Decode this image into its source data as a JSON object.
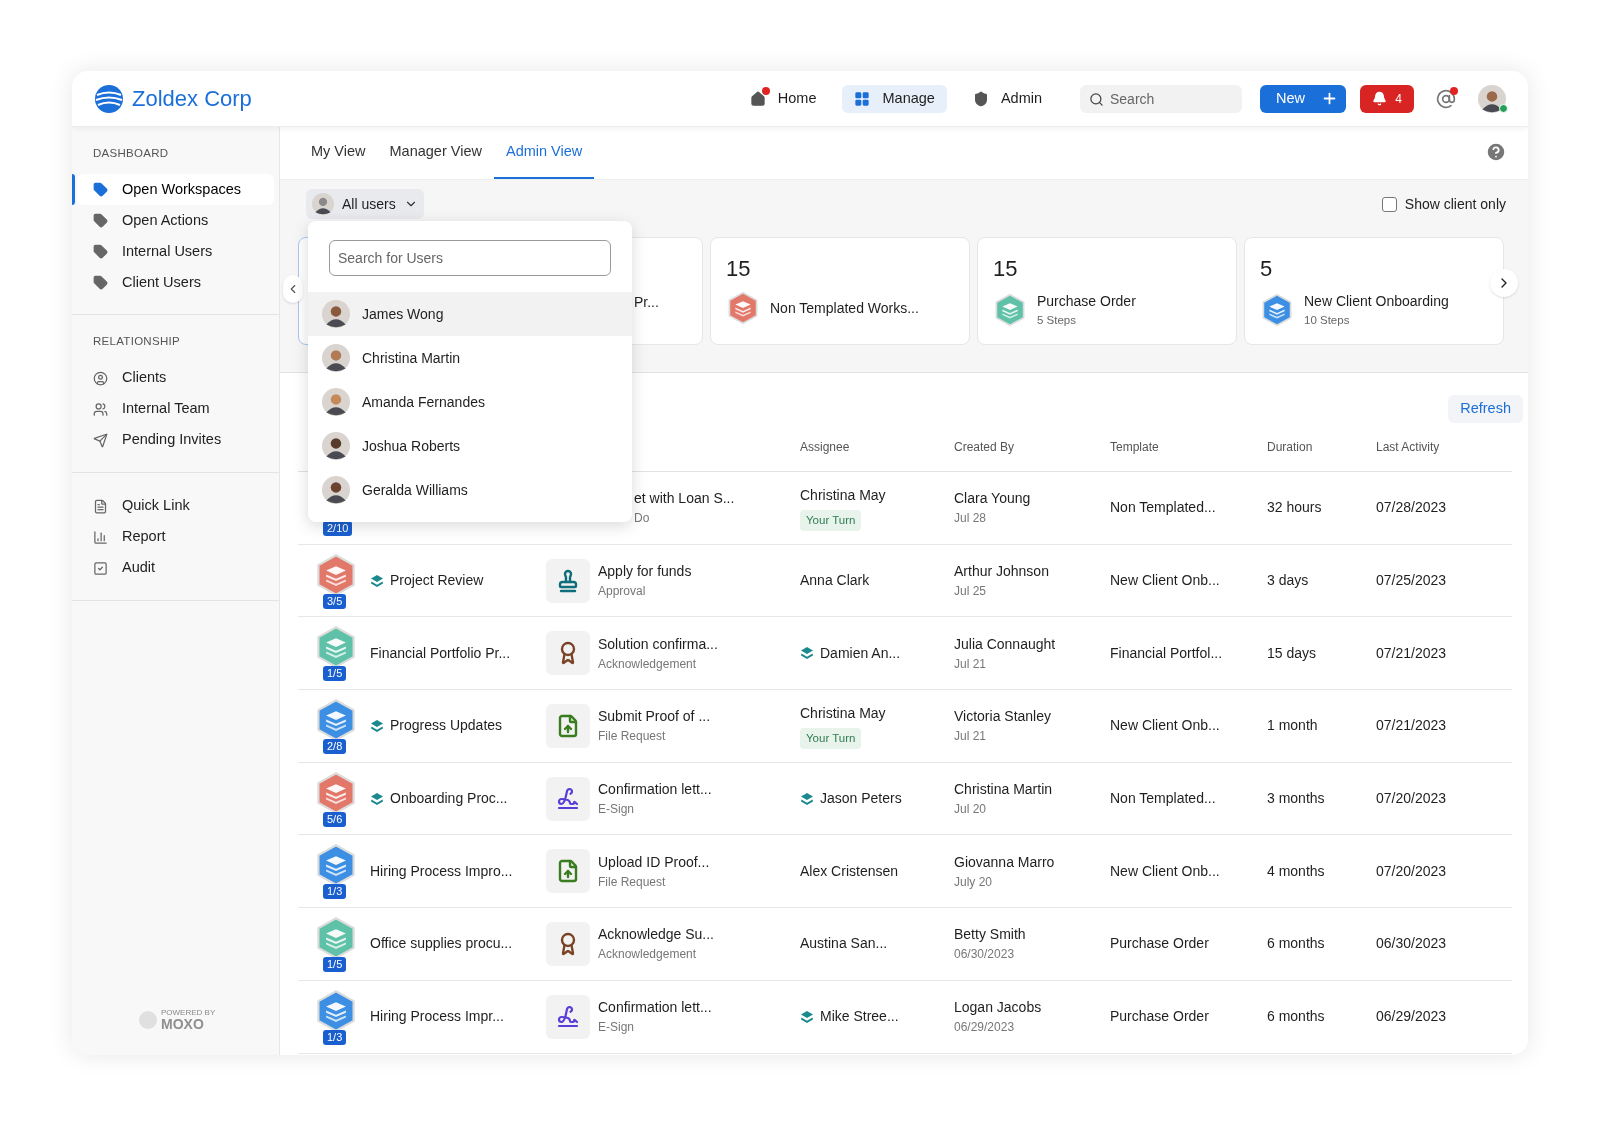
{
  "brand": {
    "name": "Zoldex Corp"
  },
  "nav": [
    {
      "label": "Home",
      "selected": false,
      "dot": true
    },
    {
      "label": "Manage",
      "selected": true,
      "dot": false
    },
    {
      "label": "Admin",
      "selected": false,
      "dot": false
    }
  ],
  "search": {
    "placeholder": "Search"
  },
  "new_button": {
    "label": "New"
  },
  "notifications": {
    "count": "4"
  },
  "mentions": {
    "dot": true
  },
  "profile": {
    "online": true
  },
  "sidebar": {
    "sections": [
      {
        "title": "DASHBOARD",
        "items": [
          {
            "label": "Open Workspaces",
            "selected": true
          },
          {
            "label": "Open Actions",
            "selected": false
          },
          {
            "label": "Internal Users",
            "selected": false
          },
          {
            "label": "Client Users",
            "selected": false
          }
        ]
      },
      {
        "title": "RELATIONSHIP",
        "items": [
          {
            "label": "Clients",
            "selected": false
          },
          {
            "label": "Internal Team",
            "selected": false
          },
          {
            "label": "Pending Invites",
            "selected": false
          }
        ]
      },
      {
        "items": [
          {
            "label": "Quick Link",
            "selected": false
          },
          {
            "label": "Report",
            "selected": false
          },
          {
            "label": "Audit",
            "selected": false
          }
        ]
      }
    ],
    "footer": {
      "caption": "POWERED BY",
      "brand": "MOXO"
    }
  },
  "tabs": [
    {
      "label": "My View",
      "selected": false
    },
    {
      "label": "Manager View",
      "selected": false
    },
    {
      "label": "Admin View",
      "selected": true
    }
  ],
  "user_filter": {
    "label": "All users"
  },
  "show_client_only": {
    "label": "Show client only",
    "checked": false
  },
  "cards": [
    {
      "kind": "partial",
      "selected": true
    },
    {
      "kind": "partial",
      "selected": false,
      "name": "Pr..."
    },
    {
      "kind": "full",
      "selected": false,
      "count": "15",
      "name": "Non Templated Works...",
      "color": "#e2786a"
    },
    {
      "kind": "full",
      "selected": false,
      "count": "15",
      "name": "Purchase Order",
      "steps": "5 Steps",
      "color": "#5fc1a8"
    },
    {
      "kind": "full",
      "selected": false,
      "count": "5",
      "name": "New Client Onboarding",
      "steps": "10 Steps",
      "color": "#3d8fe3"
    }
  ],
  "dropdown": {
    "search": {
      "placeholder": "Search for Users"
    },
    "users": [
      {
        "name": "James Wong",
        "selected": true
      },
      {
        "name": "Christina Martin",
        "selected": false
      },
      {
        "name": "Amanda Fernandes",
        "selected": false
      },
      {
        "name": "Joshua Roberts",
        "selected": false
      },
      {
        "name": "Geralda Williams",
        "selected": false
      }
    ]
  },
  "refresh": {
    "label": "Refresh"
  },
  "table": {
    "columns": [
      {
        "label": "Assignee"
      },
      {
        "label": "Created By"
      },
      {
        "label": "Template"
      },
      {
        "label": "Duration"
      },
      {
        "label": "Last Activity"
      }
    ],
    "rows": [
      {
        "workspace": {
          "badge": "2/10"
        },
        "action": {
          "title": "et with Loan S...",
          "subtitle": "Do"
        },
        "assignee": {
          "name": "Christina May",
          "group": false,
          "your_turn": "Your Turn"
        },
        "created_by": {
          "name": "Clara Young",
          "date": "Jul 28"
        },
        "template": "Non Templated...",
        "duration": "32 hours",
        "last_activity": "07/28/2023"
      },
      {
        "workspace": {
          "badge": "3/5",
          "color": "#e2786a",
          "name": "Project Review",
          "flow": true
        },
        "action": {
          "kind": "approval",
          "title": "Apply for funds",
          "subtitle": "Approval"
        },
        "assignee": {
          "name": "Anna Clark",
          "group": false
        },
        "created_by": {
          "name": "Arthur Johnson",
          "date": "Jul 25"
        },
        "template": "New Client Onb...",
        "duration": "3 days",
        "last_activity": "07/25/2023"
      },
      {
        "workspace": {
          "badge": "1/5",
          "color": "#5fc1a8",
          "name": "Financial Portfolio Pr...",
          "flow": false
        },
        "action": {
          "kind": "acknowledgement",
          "title": "Solution confirma...",
          "subtitle": "Acknowledgement"
        },
        "assignee": {
          "name": "Damien An...",
          "group": true
        },
        "created_by": {
          "name": "Julia Connaught",
          "date": "Jul 21"
        },
        "template": "Financial Portfol...",
        "duration": "15 days",
        "last_activity": "07/21/2023"
      },
      {
        "workspace": {
          "badge": "2/8",
          "color": "#3d8fe3",
          "name": "Progress Updates",
          "flow": true
        },
        "action": {
          "kind": "file_request",
          "title": "Submit Proof of ...",
          "subtitle": "File Request"
        },
        "assignee": {
          "name": "Christina May",
          "group": false,
          "your_turn": "Your Turn"
        },
        "created_by": {
          "name": "Victoria Stanley",
          "date": "Jul 21"
        },
        "template": "New Client Onb...",
        "duration": "1 month",
        "last_activity": "07/21/2023"
      },
      {
        "workspace": {
          "badge": "5/6",
          "color": "#e2786a",
          "name": "Onboarding Proc...",
          "flow": true
        },
        "action": {
          "kind": "esign",
          "title": "Confirmation lett...",
          "subtitle": "E-Sign"
        },
        "assignee": {
          "name": "Jason Peters",
          "group": true
        },
        "created_by": {
          "name": "Christina Martin",
          "date": "Jul 20"
        },
        "template": "Non Templated...",
        "duration": "3 months",
        "last_activity": "07/20/2023"
      },
      {
        "workspace": {
          "badge": "1/3",
          "color": "#3d8fe3",
          "name": "Hiring Process Impro...",
          "flow": false
        },
        "action": {
          "kind": "file_request",
          "title": "Upload ID Proof...",
          "subtitle": "File Request"
        },
        "assignee": {
          "name": "Alex Cristensen",
          "group": false
        },
        "created_by": {
          "name": "Giovanna Marro",
          "date": "July 20"
        },
        "template": "New Client Onb...",
        "duration": "4 months",
        "last_activity": "07/20/2023"
      },
      {
        "workspace": {
          "badge": "1/5",
          "color": "#5fc1a8",
          "name": "Office supplies procu...",
          "flow": false
        },
        "action": {
          "kind": "acknowledgement",
          "title": "Acknowledge Su...",
          "subtitle": "Acknowledgement"
        },
        "assignee": {
          "name": "Austina San...",
          "group": false
        },
        "created_by": {
          "name": "Betty Smith",
          "date": "06/30/2023"
        },
        "template": "Purchase Order",
        "duration": "6 months",
        "last_activity": "06/30/2023"
      },
      {
        "workspace": {
          "badge": "1/3",
          "color": "#3d8fe3",
          "name": "Hiring Process Impr...",
          "flow": false
        },
        "action": {
          "kind": "esign",
          "title": "Confirmation lett...",
          "subtitle": "E-Sign"
        },
        "assignee": {
          "name": "Mike Stree...",
          "group": true
        },
        "created_by": {
          "name": "Logan Jacobs",
          "date": "06/29/2023"
        },
        "template": "Purchase Order",
        "duration": "6 months",
        "last_activity": "06/29/2023"
      }
    ]
  }
}
